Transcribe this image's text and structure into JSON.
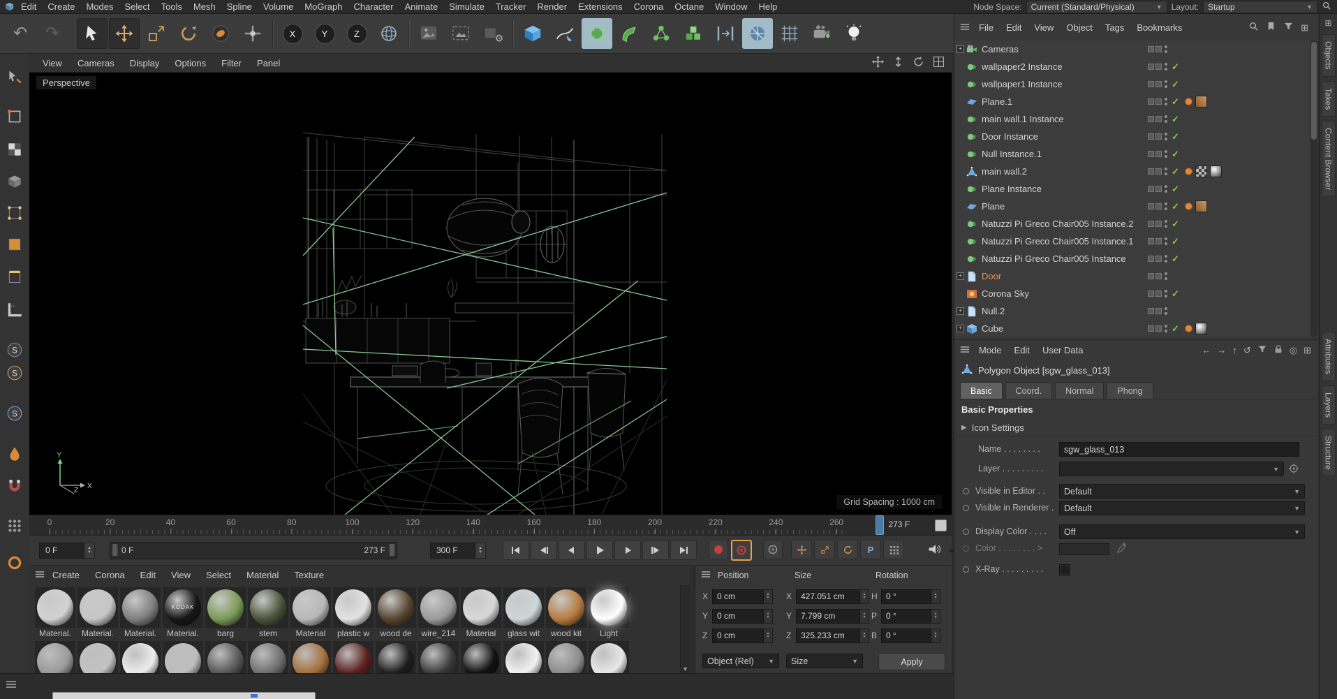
{
  "app": {
    "menubar": [
      "Edit",
      "Create",
      "Modes",
      "Select",
      "Tools",
      "Mesh",
      "Spline",
      "Volume",
      "MoGraph",
      "Character",
      "Animate",
      "Simulate",
      "Tracker",
      "Render",
      "Extensions",
      "Corona",
      "Octane",
      "Window",
      "Help"
    ],
    "node_space_label": "Node Space:",
    "node_space_value": "Current (Standard/Physical)",
    "layout_label": "Layout:",
    "layout_value": "Startup"
  },
  "toolbar": {
    "groups": [
      [
        "undo",
        "redo"
      ],
      [
        "live-selection",
        "move",
        "scale",
        "rotate",
        "last-tool",
        "axis-tool"
      ],
      [
        "lock-x",
        "lock-y",
        "lock-z",
        "world-coords"
      ],
      [
        "render-view",
        "render-region",
        "render-settings"
      ],
      [
        "primitive-cube",
        "spline-pen",
        "subdivision-surface",
        "deformer",
        "mograph-array",
        "volume",
        "fields",
        "simulation",
        "workplane",
        "motion-camera",
        "light"
      ]
    ],
    "axis_locks": [
      "X",
      "Y",
      "Z"
    ]
  },
  "left_palette": [
    "make-editable",
    "model-mode",
    "texture-mode",
    "workplane-mode",
    "point-mode",
    "polygon-mode",
    "edge-mode",
    "axis-mode",
    "snap-solo",
    "snap-child",
    "snap-all",
    "paint-tool",
    "magnet-tool",
    "array-tool",
    "marker-tool"
  ],
  "viewport": {
    "menu": [
      "View",
      "Cameras",
      "Display",
      "Options",
      "Filter",
      "Panel"
    ],
    "nav_icons": [
      "pan-view-icon",
      "zoom-view-icon",
      "rotate-view-icon",
      "toggle-views-icon"
    ],
    "camera_label": "Perspective",
    "grid_spacing": "Grid Spacing : 1000 cm",
    "axis": {
      "x": "X",
      "y": "Y",
      "z": "Z"
    }
  },
  "timeline": {
    "ticks": [
      0,
      20,
      40,
      60,
      80,
      100,
      120,
      140,
      160,
      180,
      200,
      220,
      240,
      260
    ],
    "playhead_frame": 273,
    "playhead_label": "273 F",
    "current_frame": "0 F",
    "range_start": "0 F",
    "range_end": "273 F",
    "last_frame": "300 F",
    "transport": [
      "jump-start-button",
      "previous-key-button",
      "previous-frame-button",
      "play-button",
      "next-frame-button",
      "next-key-button",
      "jump-end-button"
    ],
    "anim_toggles": [
      {
        "name": "record-button"
      },
      {
        "name": "autokey-button",
        "active": true
      },
      {
        "name": "keyframe-selection-button"
      },
      {
        "name": "key-position-toggle"
      },
      {
        "name": "key-scale-toggle"
      },
      {
        "name": "key-rotation-toggle"
      },
      {
        "name": "key-parameter-toggle",
        "letter": "P"
      },
      {
        "name": "key-pla-toggle"
      }
    ]
  },
  "materials": {
    "menu": [
      "Create",
      "Corona",
      "Edit",
      "View",
      "Select",
      "Material",
      "Texture"
    ],
    "row1": [
      {
        "label": "Material.",
        "color": "#d2d2d2"
      },
      {
        "label": "Material.",
        "color": "#c6c6c6"
      },
      {
        "label": "Material.",
        "color": "#7e7e7e"
      },
      {
        "label": "Material.",
        "color": "#161616",
        "text": "KODAK"
      },
      {
        "label": "barg",
        "color": "#7a9a55"
      },
      {
        "label": "stem",
        "color": "#49543a"
      },
      {
        "label": "Material",
        "color": "#b8b8b8"
      },
      {
        "label": "plastic w",
        "color": "#e2e2e2"
      },
      {
        "label": "wood de",
        "color": "#57442f"
      },
      {
        "label": "wire_214",
        "color": "#9a9a9a",
        "checker": true
      },
      {
        "label": "Material",
        "color": "#d8d8d8"
      },
      {
        "label": "glass wit",
        "color": "#cdd6d9"
      },
      {
        "label": "wood kit",
        "color": "#b67b3e"
      },
      {
        "label": "Light",
        "color": "#ffffff"
      }
    ],
    "row2_colors": [
      "#9a9a9a",
      "#c2c2c2",
      "#ededed",
      "#bdbdbd",
      "#585858",
      "#6e6e6e",
      "#a4703c",
      "#5c2020",
      "#1d1d1d",
      "#3c3c3c",
      "#101010",
      "#f2f2f2",
      "#8c8c8c",
      "#e8e8e8"
    ]
  },
  "coordinates": {
    "headers": {
      "position": "Position",
      "size": "Size",
      "rotation": "Rotation"
    },
    "position": [
      {
        "axis": "X",
        "value": "0 cm"
      },
      {
        "axis": "Y",
        "value": "0 cm"
      },
      {
        "axis": "Z",
        "value": "0 cm"
      }
    ],
    "size": [
      {
        "axis": "X",
        "value": "427.051 cm"
      },
      {
        "axis": "Y",
        "value": "7.799 cm"
      },
      {
        "axis": "Z",
        "value": "325.233 cm"
      }
    ],
    "rotation": [
      {
        "axis": "H",
        "value": "0 °"
      },
      {
        "axis": "P",
        "value": "0 °"
      },
      {
        "axis": "B",
        "value": "0 °"
      }
    ],
    "mode_dropdown": "Object (Rel)",
    "size_dropdown": "Size",
    "apply_label": "Apply"
  },
  "object_manager": {
    "menu": [
      "File",
      "Edit",
      "View",
      "Object",
      "Tags",
      "Bookmarks"
    ],
    "icons": [
      "search-icon",
      "bookmark-icon",
      "filter-icon",
      "layout-icon"
    ],
    "items": [
      {
        "label": "Cameras",
        "icon": "camera",
        "expander": true,
        "check": false,
        "tags": []
      },
      {
        "label": "wallpaper2 Instance",
        "icon": "instance",
        "check": true,
        "tags": []
      },
      {
        "label": "wallpaper1 Instance",
        "icon": "instance",
        "check": true,
        "tags": []
      },
      {
        "label": "Plane.1",
        "icon": "plane",
        "check": true,
        "tags": [
          "orange",
          "wood"
        ]
      },
      {
        "label": "main wall.1 Instance",
        "icon": "instance",
        "check": true,
        "tags": []
      },
      {
        "label": "Door Instance",
        "icon": "instance",
        "check": true,
        "tags": []
      },
      {
        "label": "Null Instance.1",
        "icon": "instance",
        "check": true,
        "tags": []
      },
      {
        "label": "main wall.2",
        "icon": "polygon",
        "check": true,
        "tags": [
          "orange",
          "checker",
          "sphere"
        ]
      },
      {
        "label": "Plane Instance",
        "icon": "instance",
        "check": true,
        "tags": []
      },
      {
        "label": "Plane",
        "icon": "plane",
        "check": true,
        "tags": [
          "orange",
          "wood"
        ]
      },
      {
        "label": "Natuzzi Pi Greco Chair005 Instance.2",
        "icon": "instance",
        "check": true,
        "tags": []
      },
      {
        "label": "Natuzzi Pi Greco Chair005 Instance.1",
        "icon": "instance",
        "check": true,
        "tags": []
      },
      {
        "label": "Natuzzi Pi Greco Chair005 Instance",
        "icon": "instance",
        "check": true,
        "tags": []
      },
      {
        "label": "Door",
        "icon": "page",
        "expander": true,
        "selected": true,
        "check": false,
        "tags": []
      },
      {
        "label": "Corona Sky",
        "icon": "sky",
        "check": true,
        "tags": []
      },
      {
        "label": "Null.2",
        "icon": "page",
        "expander": true,
        "check": false,
        "tags": []
      },
      {
        "label": "Cube",
        "icon": "cube",
        "expander": true,
        "check": true,
        "tags": [
          "orange",
          "sphere"
        ]
      }
    ]
  },
  "attributes": {
    "menu": [
      "Mode",
      "Edit",
      "User Data"
    ],
    "nav_icons": [
      "back-icon",
      "forward-icon",
      "up-icon",
      "history-icon",
      "filter-icon",
      "lock-icon",
      "focus-icon",
      "add-panel-icon"
    ],
    "title": "Polygon Object [sgw_glass_013]",
    "tabs": [
      {
        "label": "Basic",
        "active": true
      },
      {
        "label": "Coord.",
        "active": false
      },
      {
        "label": "Normal",
        "active": false
      },
      {
        "label": "Phong",
        "active": false
      }
    ],
    "section_title": "Basic Properties",
    "icon_settings": "Icon Settings",
    "rows": {
      "name_label": "Name . . . . . . . .",
      "name_value": "sgw_glass_013",
      "layer_label": "Layer . . . . . . . . .",
      "visible_editor_label": "Visible in Editor . .",
      "visible_editor_value": "Default",
      "visible_renderer_label": "Visible in Renderer .",
      "visible_renderer_value": "Default",
      "display_color_label": "Display Color . . . .",
      "display_color_value": "Off",
      "color_label": "Color . . . . . . . . >",
      "xray_label": "X-Ray . . . . . . . . ."
    }
  },
  "side_tabs": {
    "top": [
      "Objects",
      "Takes",
      "Content Browser"
    ],
    "bottom": [
      "Attributes",
      "Layers",
      "Structure"
    ]
  }
}
